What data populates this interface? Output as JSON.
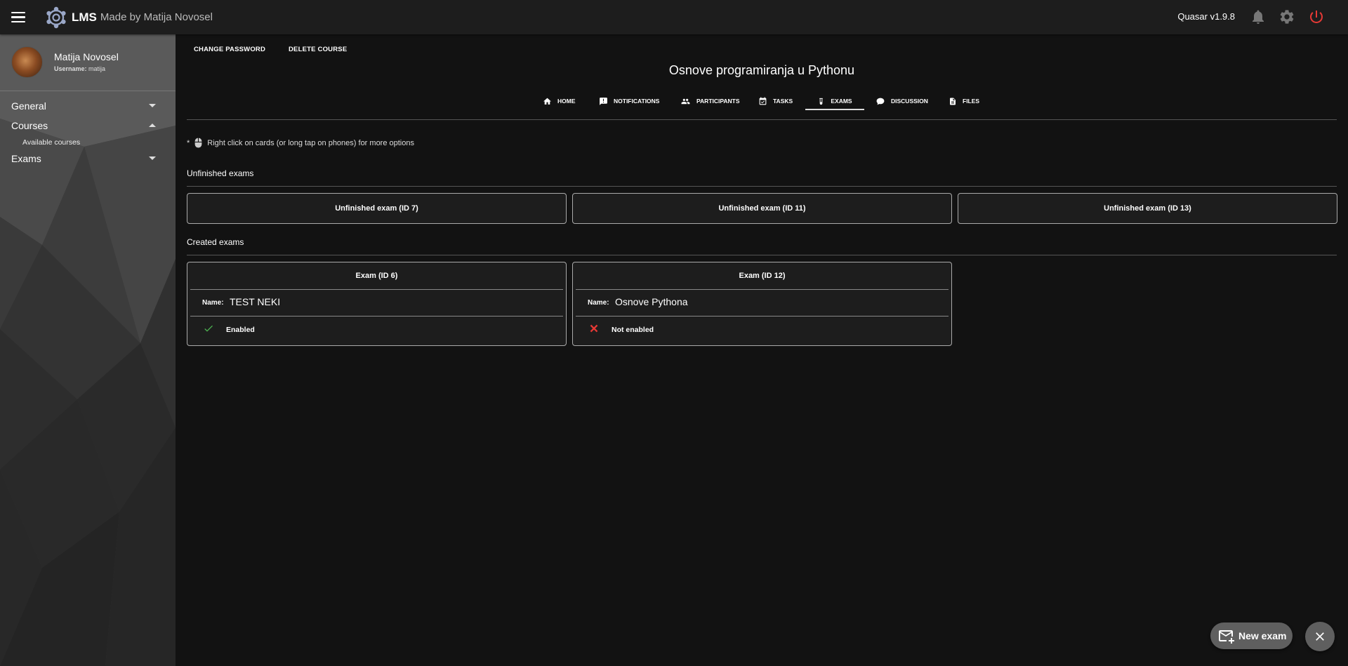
{
  "header": {
    "app_title": "LMS",
    "app_subtitle": "Made by Matija Novosel",
    "version": "Quasar v1.9.8",
    "icons": [
      "menu-icon",
      "logo-icon",
      "notifications-icon",
      "settings-icon",
      "power-icon"
    ],
    "accent_color": "#e53935"
  },
  "sidebar": {
    "profile_name": "Matija Novosel",
    "username_label": "Username:",
    "username_value": "matija",
    "items": [
      {
        "label": "General",
        "expanded": false
      },
      {
        "label": "Courses",
        "expanded": true,
        "children": [
          "Available courses"
        ]
      },
      {
        "label": "Exams",
        "expanded": false
      }
    ]
  },
  "main": {
    "top_buttons": [
      "CHANGE PASSWORD",
      "DELETE COURSE"
    ],
    "course_title": "Osnove programiranja u Pythonu",
    "tabs": [
      {
        "label": "HOME",
        "icon": "home-icon"
      },
      {
        "label": "NOTIFICATIONS",
        "icon": "announcement-icon"
      },
      {
        "label": "PARTICIPANTS",
        "icon": "people-icon"
      },
      {
        "label": "TASKS",
        "icon": "calendar-check-icon"
      },
      {
        "label": "EXAMS",
        "icon": "test-tube-icon",
        "active": true
      },
      {
        "label": "DISCUSSION",
        "icon": "chat-icon"
      },
      {
        "label": "FILES",
        "icon": "file-icon"
      }
    ],
    "hint_prefix": "*",
    "hint_text": "Right click on cards (or long tap on phones) for more options",
    "unfinished_title": "Unfinished exams",
    "unfinished": [
      "Unfinished exam (ID 7)",
      "Unfinished exam (ID 11)",
      "Unfinished exam (ID 13)"
    ],
    "created_title": "Created exams",
    "created": [
      {
        "title": "Exam (ID 6)",
        "name_label": "Name:",
        "name": "TEST NEKI",
        "status": "Enabled",
        "status_icon": "check-icon",
        "status_color": "#4caf50"
      },
      {
        "title": "Exam (ID 12)",
        "name_label": "Name:",
        "name": "Osnove Pythona",
        "status": "Not enabled",
        "status_icon": "close-icon",
        "status_color": "#e53935"
      }
    ]
  },
  "fab": {
    "new_exam_label": "New exam",
    "new_exam_icon": "mail-add-icon",
    "close_icon": "close-icon"
  }
}
